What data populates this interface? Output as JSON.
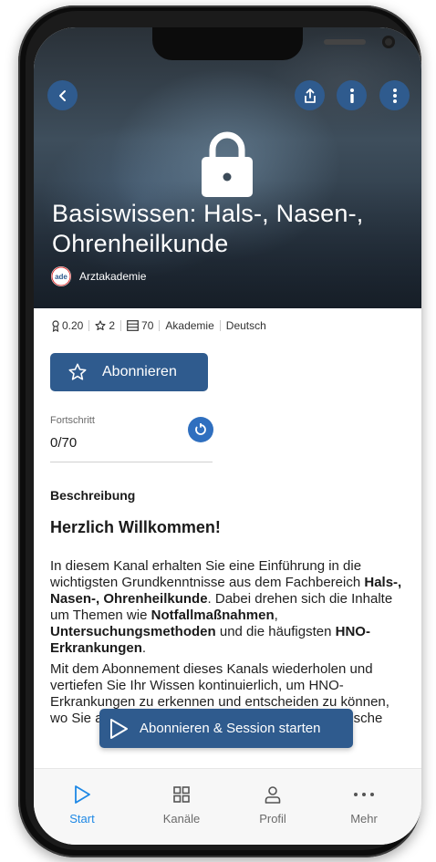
{
  "header": {
    "title": "Basiswissen: Hals-, Nasen-, Ohrenheilkunde",
    "author": "Arztakademie",
    "author_logo_text": "ade",
    "icons": [
      "back-icon",
      "share-icon",
      "info-icon",
      "more-vertical-icon",
      "lock-icon"
    ]
  },
  "meta": {
    "points": "0.20",
    "stars": "2",
    "items": "70",
    "type": "Akademie",
    "language": "Deutsch"
  },
  "subscribe_label": "Abonnieren",
  "progress": {
    "label": "Fortschritt",
    "value": "0/70"
  },
  "description": {
    "heading": "Beschreibung",
    "welcome": "Herzlich Willkommen!",
    "p1_a": "In diesem Kanal erhalten Sie eine Einführung in die wichtigsten Grundkenntnisse aus dem Fachbereich ",
    "p1_b": "Hals-, Nasen-, Ohrenheilkunde",
    "p1_c": ". Dabei drehen sich die Inhalte um Themen wie ",
    "p1_d": "Notfallmaßnahmen",
    "p1_e": ", ",
    "p1_f": "Untersuchungsmethoden",
    "p1_g": " und die häufigsten ",
    "p1_h": "HNO-Erkrankungen",
    "p1_i": ".",
    "p2": "Mit dem Abonnement dieses Kanals wiederholen und vertiefen Sie Ihr Wissen kontinuierlich, um HNO-Erkrankungen zu erkennen und entscheiden zu können, wo Sie als Allgemeinmediziner:in selbst therapeutische"
  },
  "cta_label": "Abonnieren & Session starten",
  "tabs": [
    {
      "label": "Start",
      "icon": "play-outline-icon",
      "active": true
    },
    {
      "label": "Kanäle",
      "icon": "grid-icon",
      "active": false
    },
    {
      "label": "Profil",
      "icon": "person-icon",
      "active": false
    },
    {
      "label": "Mehr",
      "icon": "more-horizontal-icon",
      "active": false
    }
  ],
  "colors": {
    "accent": "#2f5b8e",
    "active_tab": "#1e88e5"
  }
}
